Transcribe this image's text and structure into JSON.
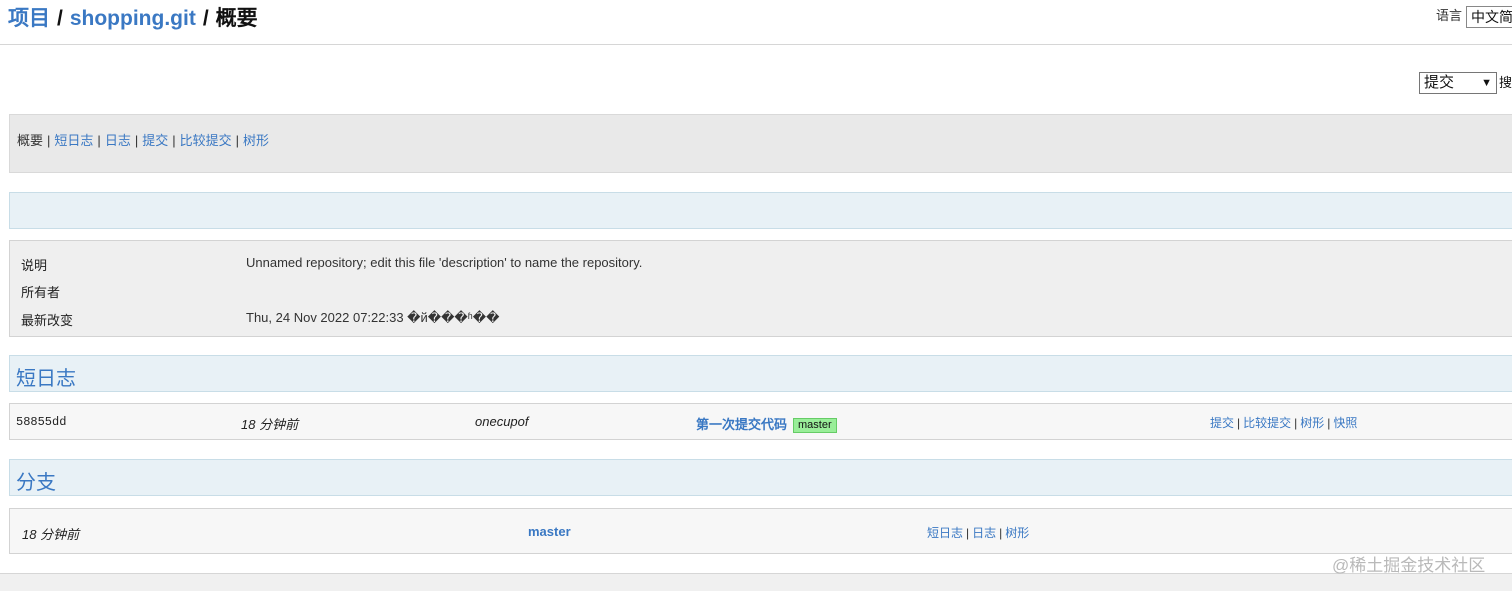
{
  "breadcrumb": {
    "projects": "项目",
    "sep1": "/",
    "repo": "shopping.git",
    "sep2": "/",
    "current": "概要"
  },
  "language": {
    "label": "语言",
    "value": "中文简"
  },
  "search": {
    "type_value": "提交",
    "trail": "搜"
  },
  "nav": {
    "current": "概要",
    "pipe": "|",
    "items": [
      "短日志",
      "日志",
      "提交",
      "比较提交",
      "树形"
    ]
  },
  "info": {
    "rows": [
      {
        "label": "说明",
        "value": "Unnamed repository; edit this file 'description' to name the repository."
      },
      {
        "label": "所有者",
        "value": ""
      },
      {
        "label": "最新改变",
        "value": "Thu, 24 Nov 2022 07:22:33 �й���ʱ��"
      }
    ]
  },
  "shortlog": {
    "title": "短日志",
    "rows": [
      {
        "hash": "58855dd",
        "age": "18 分钟前",
        "author": "onecupof",
        "message": "第一次提交代码",
        "ref": "master",
        "actions": [
          "提交",
          "比较提交",
          "树形",
          "快照"
        ]
      }
    ]
  },
  "branches": {
    "title": "分支",
    "rows": [
      {
        "age": "18 分钟前",
        "name": "master",
        "actions": [
          "短日志",
          "日志",
          "树形"
        ]
      }
    ]
  },
  "watermark": "@稀土掘金技术社区"
}
